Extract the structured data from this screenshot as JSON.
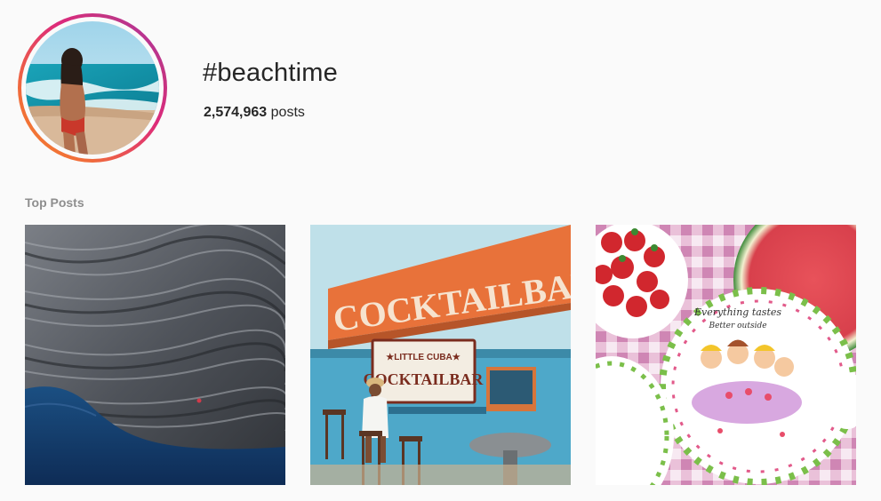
{
  "hashtag": {
    "title": "#beachtime",
    "post_count": "2,574,963",
    "post_unit": "posts"
  },
  "section": {
    "top_posts_label": "Top Posts"
  },
  "tile2_sign": {
    "big_sign": "COCKTAILBAR",
    "small_sign_top": "★LITTLE CUBA★",
    "small_sign_bottom": "COCKTAILBAR"
  },
  "tile3_plate": {
    "line1": "Everything tastes",
    "line2": "Better outside"
  },
  "colors": {
    "ring_start": "#f58529",
    "ring_end": "#c13584",
    "label_gray": "#8e8e8e",
    "text": "#262626"
  }
}
